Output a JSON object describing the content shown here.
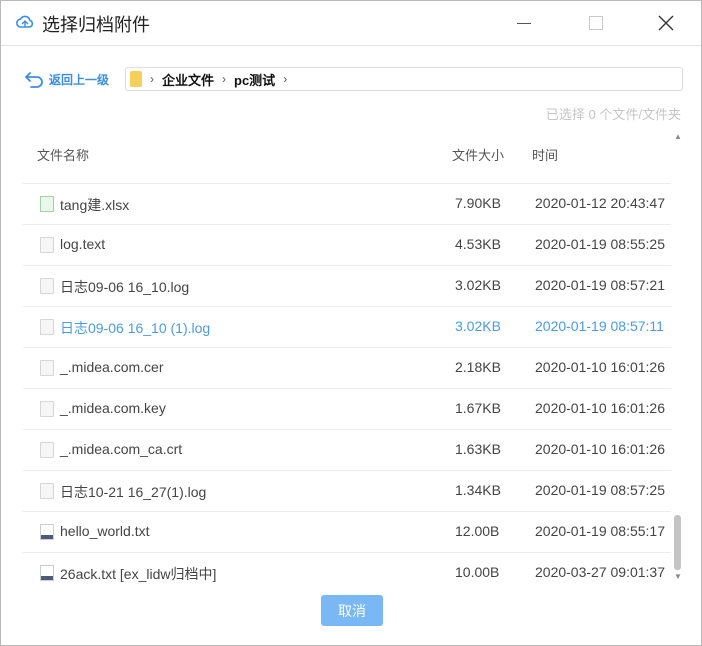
{
  "window": {
    "title": "选择归档附件"
  },
  "nav": {
    "back_label": "返回上一级",
    "breadcrumbs": [
      "企业文件",
      "pc测试"
    ],
    "separator": "›"
  },
  "selection_info": "已选择 0 个文件/文件夹",
  "table": {
    "headers": {
      "name": "文件名称",
      "size": "文件大小",
      "time": "时间"
    },
    "rows": [
      {
        "icon": "xlsx-file-icon",
        "name": "tang建.xlsx",
        "size": "7.90KB",
        "time": "2020-01-12 20:43:47"
      },
      {
        "icon": "generic-file-icon",
        "name": "log.text",
        "size": "4.53KB",
        "time": "2020-01-19 08:55:25"
      },
      {
        "icon": "generic-file-icon",
        "name": "日志09-06 16_10.log",
        "size": "3.02KB",
        "time": "2020-01-19 08:57:21"
      },
      {
        "icon": "generic-file-icon",
        "name": "日志09-06 16_10 (1).log",
        "size": "3.02KB",
        "time": "2020-01-19 08:57:11"
      },
      {
        "icon": "generic-file-icon",
        "name": "_.midea.com.cer",
        "size": "2.18KB",
        "time": "2020-01-10 16:01:26"
      },
      {
        "icon": "generic-file-icon",
        "name": "_.midea.com.key",
        "size": "1.67KB",
        "time": "2020-01-10 16:01:26"
      },
      {
        "icon": "generic-file-icon",
        "name": "_.midea.com_ca.crt",
        "size": "1.63KB",
        "time": "2020-01-10 16:01:26"
      },
      {
        "icon": "generic-file-icon",
        "name": "日志10-21 16_27(1).log",
        "size": "1.34KB",
        "time": "2020-01-19 08:57:25"
      },
      {
        "icon": "txt-file-icon",
        "name": "hello_world.txt",
        "size": "12.00B",
        "time": "2020-01-19 08:55:17"
      },
      {
        "icon": "txt-file-icon",
        "name": "26ack.txt [ex_lidw归档中]",
        "size": "10.00B",
        "time": "2020-03-27 09:01:37"
      }
    ]
  },
  "buttons": {
    "cancel": "取消"
  },
  "colors": {
    "accent": "#3a8ee6",
    "row_highlight": "#4a9be8",
    "cancel_bg": "#7ab8f5",
    "folder": "#f5cf5a"
  }
}
